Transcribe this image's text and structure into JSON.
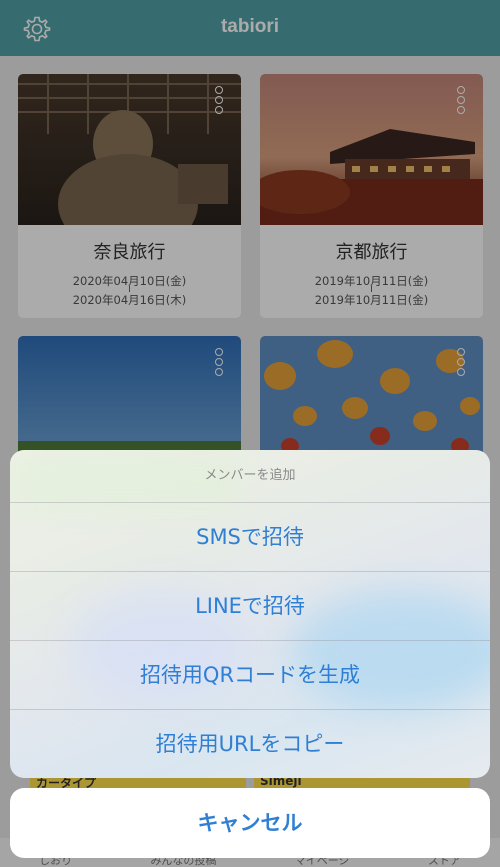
{
  "header": {
    "title": "tabiori",
    "settings_icon": "gear-icon"
  },
  "trips": [
    {
      "name": "奈良旅行",
      "start": "2020年04月10日(金)",
      "end": "2020年04月16日(木)"
    },
    {
      "name": "京都旅行",
      "start": "2019年10月11日(金)",
      "end": "2019年10月11日(金)"
    },
    {
      "name": "",
      "start": "",
      "end": ""
    },
    {
      "name": "",
      "start": "",
      "end": ""
    }
  ],
  "ad_banner": {
    "items": [
      "カータイプ",
      "Simeji"
    ]
  },
  "tabbar": {
    "items": [
      "しおり",
      "みんなの投稿",
      "マイページ",
      "ストア"
    ]
  },
  "action_sheet": {
    "title": "メンバーを追加",
    "options": [
      "SMSで招待",
      "LINEで招待",
      "招待用QRコードを生成",
      "招待用URLをコピー"
    ],
    "cancel": "キャンセル"
  },
  "colors": {
    "header_bg": "#51a2a6",
    "action_text": "#2f7fd4"
  }
}
